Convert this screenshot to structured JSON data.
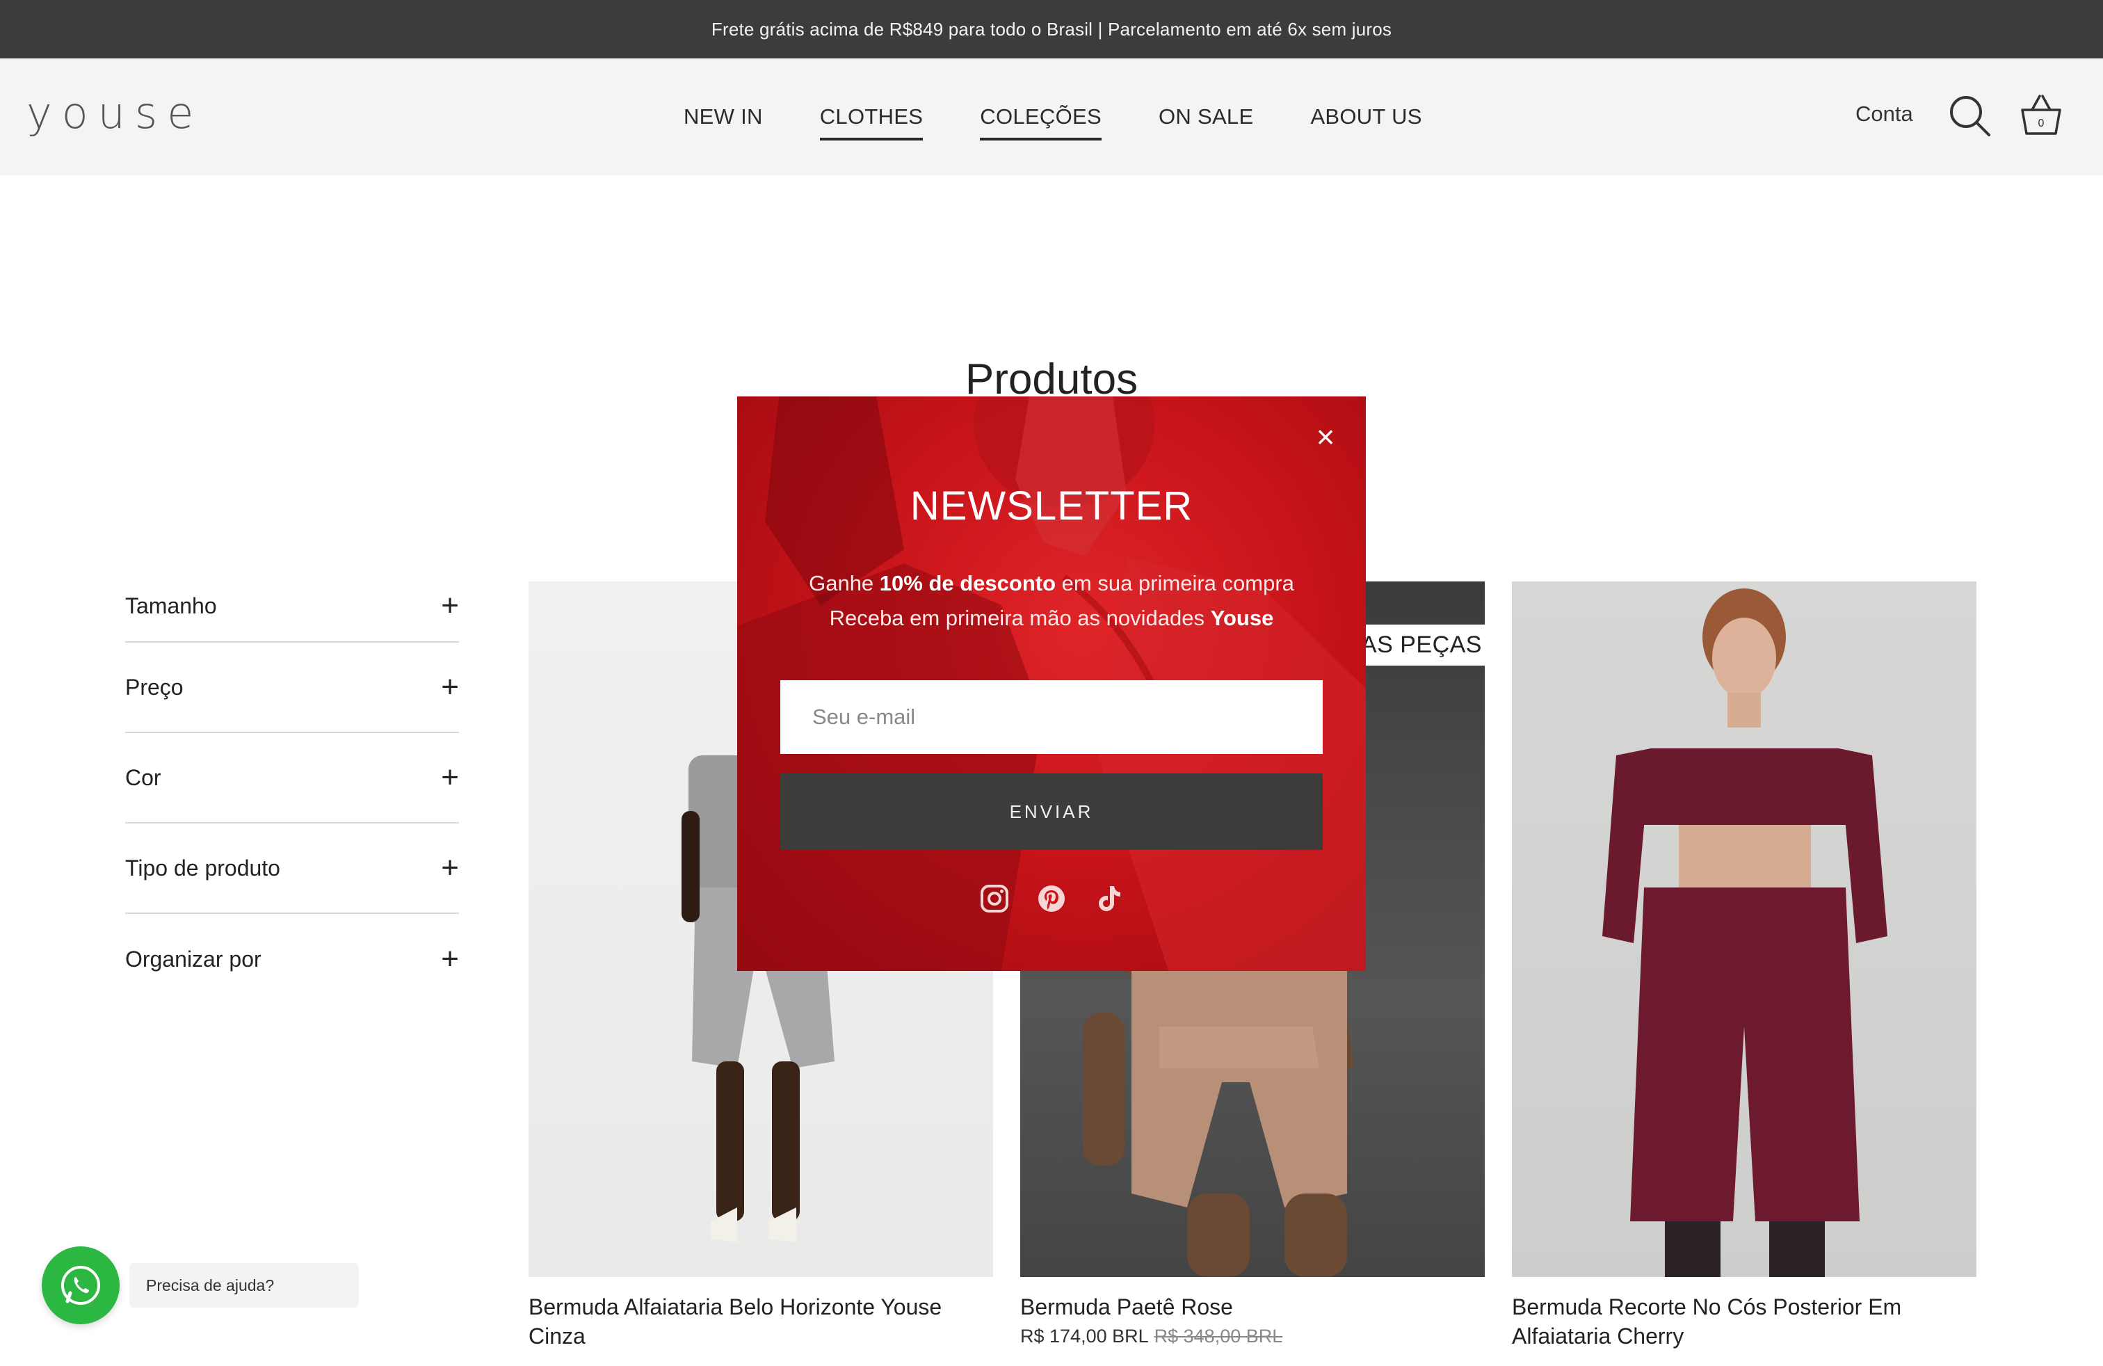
{
  "announcement": "Frete grátis acima de R$849 para todo o Brasil | Parcelamento em até 6x sem juros",
  "header": {
    "logo": "youse",
    "nav": [
      "NEW IN",
      "CLOTHES",
      "COLEÇÕES",
      "ON SALE",
      "ABOUT US"
    ],
    "account": "Conta",
    "cart_count": "0"
  },
  "page": {
    "title": "Produtos"
  },
  "filters": [
    "Tamanho",
    "Preço",
    "Cor",
    "Tipo de produto",
    "Organizar por"
  ],
  "products": [
    {
      "name": "Bermuda Alfaiataria Belo Horizonte Youse Cinza"
    },
    {
      "name": "Bermuda Paetê Rose",
      "price": "R$ 174,00 BRL",
      "compare_price": "R$ 348,00 BRL",
      "ribbon": "AS PEÇAS"
    },
    {
      "name": "Bermuda Recorte No Cós Posterior Em Alfaiataria Cherry"
    }
  ],
  "newsletter": {
    "title": "NEWSLETTER",
    "line1_a": "Ganhe ",
    "line1_bold": "10% de desconto",
    "line1_b": " em sua primeira compra",
    "line2_a": "Receba em primeira mão as novidades ",
    "line2_bold": "Youse",
    "email_placeholder": "Seu e-mail",
    "submit_label": "ENVIAR",
    "close": "×"
  },
  "help": {
    "label": "Precisa de ajuda?"
  },
  "icons": [
    "search-icon",
    "cart-icon",
    "plus-icon",
    "close-icon",
    "instagram-icon",
    "pinterest-icon",
    "tiktok-icon",
    "whatsapp-icon"
  ],
  "colors": {
    "announcement_bg": "#3c3c3a",
    "modal_red": "#c8141a",
    "whatsapp": "#2bb741"
  }
}
